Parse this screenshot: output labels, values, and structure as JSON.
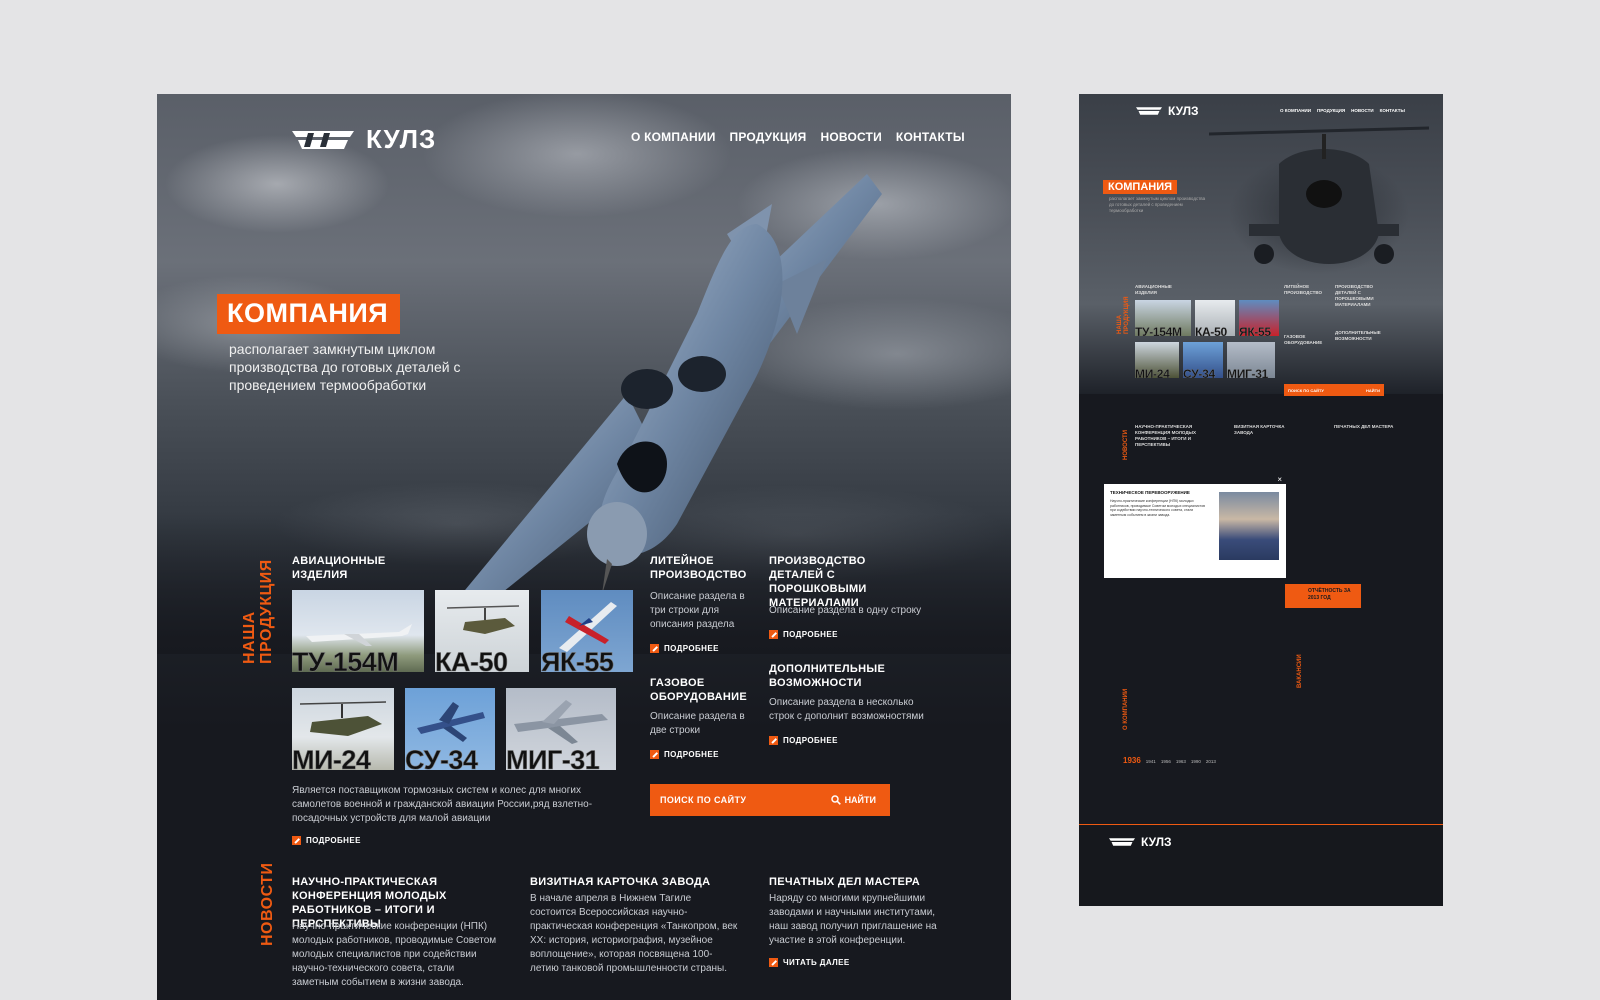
{
  "brand": {
    "name": "КУЛЗ",
    "mark": "УВЗ"
  },
  "nav": [
    "О КОМПАНИИ",
    "ПРОДУКЦИЯ",
    "НОВОСТИ",
    "КОНТАКТЫ"
  ],
  "hero": {
    "badge": "КОМПАНИЯ",
    "subtitle": "располагает замкнутым циклом производства до готовых деталей с проведением термообработки"
  },
  "products": {
    "label": "НАША\nПРОДУКЦИЯ",
    "aviation": {
      "title": "АВИАЦИОННЫЕ ИЗДЕЛИЯ",
      "thumbs": [
        "ТУ-154М",
        "КА-50",
        "ЯК-55",
        "МИ-24",
        "СУ-34",
        "МИГ-31"
      ],
      "description": "Является поставщиком тормозных систем и колес для многих самолетов военной и гражданской авиации России,ряд взлетно-посадочных устройств для малой авиации",
      "more": "ПОДРОБНЕЕ"
    },
    "casting": {
      "title": "ЛИТЕЙНОЕ ПРОИЗВОДСТВО",
      "description": "Описание раздела в три строки для описания раздела",
      "more": "ПОДРОБНЕЕ"
    },
    "powder": {
      "title": "ПРОИЗВОДСТВО ДЕТАЛЕЙ С ПОРОШКОВЫМИ МАТЕРИАЛАМИ",
      "description": "Описание раздела в одну строку",
      "more": "ПОДРОБНЕЕ"
    },
    "gas": {
      "title": "ГАЗОВОЕ ОБОРУДОВАНИЕ",
      "description": "Описание раздела в две строки",
      "more": "ПОДРОБНЕЕ"
    },
    "extra": {
      "title": "ДОПОЛНИТЕЛЬНЫЕ ВОЗМОЖНОСТИ",
      "description": "Описание раздела в несколько строк с дополнит возможностями",
      "more": "ПОДРОБНЕЕ"
    }
  },
  "search": {
    "placeholder": "ПОИСК ПО САЙТУ",
    "button": "НАЙТИ"
  },
  "news": {
    "label": "НОВОСТИ",
    "items": [
      {
        "title": "НАУЧНО-ПРАКТИЧЕСКАЯ КОНФЕРЕНЦИЯ МОЛОДЫХ РАБОТНИКОВ – ИТОГИ И ПЕРСПЕКТИВЫ",
        "text": "Научно-практические конференции (НПК) молодых работников, проводимые Советом молодых специалистов при содействии научно-технического совета, стали заметным событием в жизни завода."
      },
      {
        "title": "ВИЗИТНАЯ КАРТОЧКА ЗАВОДА",
        "text": "В начале апреля в Нижнем Тагиле состоится Всероссийская научно-практическая конференция «Танкопром, век XX: история, историография, музейное воплощение», которая посвящена 100-летию танковой промышленности страны."
      },
      {
        "title": "ПЕЧАТНЫХ ДЕЛ МАСТЕРА",
        "text": "Наряду со многими крупнейшими заводами и научными институтами, наш завод получил приглашение на участие в этой конференции.",
        "more": "ЧИТАТЬ ДАЛЕЕ"
      }
    ]
  },
  "small": {
    "popup_title": "ТЕХНИЧЕСКОЕ ПЕРЕВООРУЖЕНИЕ",
    "report": "ОТЧЁТНОСТЬ ЗА 2013 ГОД",
    "labels": [
      "НАША\nПРОДУКЦИЯ",
      "НОВОСТИ",
      "О КОМПАНИИ",
      "ВАКАНСИИ"
    ],
    "thumbs": [
      "ТУ-154М",
      "КА-50",
      "ЯК-55",
      "МИ-24",
      "СУ-34",
      "МИГ-31"
    ],
    "years": [
      "1936",
      "1941",
      "1956",
      "1963",
      "1990",
      "2013"
    ]
  },
  "colors": {
    "accent": "#ef5a12",
    "bg": "#17191f",
    "page": "#e4e4e6"
  }
}
